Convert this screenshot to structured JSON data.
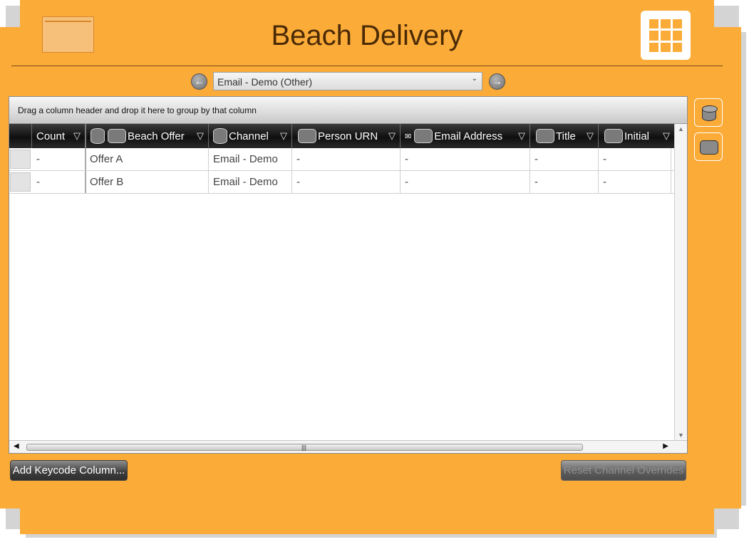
{
  "app": {
    "title": "Beach Delivery"
  },
  "nav": {
    "prev_icon": "arrow-left",
    "next_icon": "arrow-right"
  },
  "channel_select": {
    "value": "Email - Demo (Other)"
  },
  "grid": {
    "group_hint": "Drag a column header and drop it here to group by that column",
    "columns": [
      {
        "label": "Count"
      },
      {
        "label": "Beach Offer"
      },
      {
        "label": "Channel"
      },
      {
        "label": "Person URN"
      },
      {
        "label": "Email Address"
      },
      {
        "label": "Title"
      },
      {
        "label": "Initial"
      }
    ],
    "rows": [
      {
        "count": "-",
        "beach_offer": "Offer A",
        "channel": "Email - Demo",
        "person_urn": "-",
        "email_address": "-",
        "title": "-",
        "initial": "-"
      },
      {
        "count": "-",
        "beach_offer": "Offer B",
        "channel": "Email - Demo",
        "person_urn": "-",
        "email_address": "-",
        "title": "-",
        "initial": "-"
      }
    ]
  },
  "buttons": {
    "add_keycode": "Add Keycode Column...",
    "reset_overrides": "Reset Channel Overrides"
  },
  "colors": {
    "accent": "#fbab38",
    "title_text": "#4a2a06",
    "header_bg": "#1a1a1a"
  }
}
